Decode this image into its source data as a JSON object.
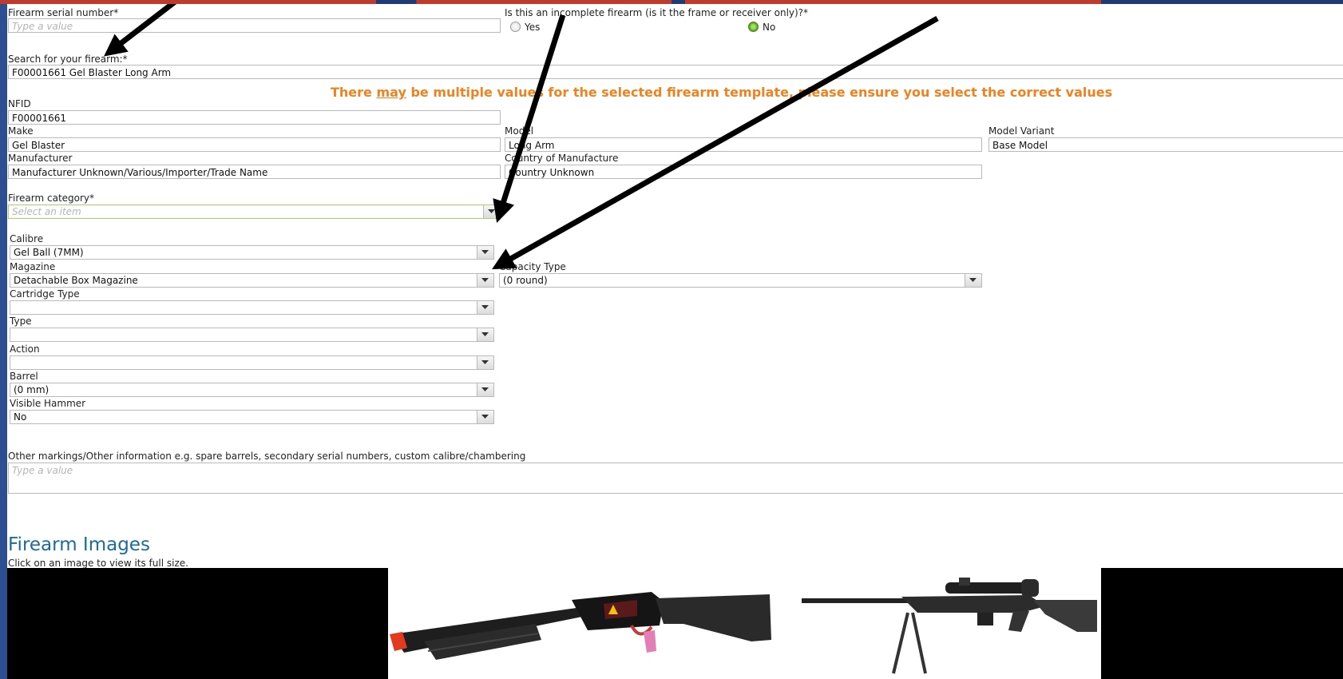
{
  "serial": {
    "label": "Firearm serial number*",
    "placeholder": "Type a value"
  },
  "incomplete": {
    "label": "Is this an incomplete firearm (is it the frame or receiver only)?*",
    "yes": "Yes",
    "no": "No"
  },
  "search": {
    "label": "Search for your firearm:*",
    "value": "F00001661 Gel Blaster Long Arm"
  },
  "notice": {
    "before": "There ",
    "emph": "may",
    "after": " be multiple values for the selected firearm template, please ensure you select the correct values"
  },
  "nfid": {
    "label": "NFID",
    "value": "F00001661"
  },
  "make": {
    "label": "Make",
    "value": "Gel Blaster"
  },
  "model": {
    "label": "Model",
    "value": "Long Arm"
  },
  "variant": {
    "label": "Model Variant",
    "value": "Base Model"
  },
  "manufacturer": {
    "label": "Manufacturer",
    "value": "Manufacturer Unknown/Various/Importer/Trade Name"
  },
  "country": {
    "label": "Country of Manufacture",
    "value": "Country Unknown"
  },
  "category": {
    "label": "Firearm category*",
    "placeholder": "Select an item"
  },
  "calibre": {
    "label": "Calibre",
    "value": "Gel Ball (7MM)"
  },
  "magazine": {
    "label": "Magazine",
    "value": "Detachable Box Magazine"
  },
  "capacity": {
    "label": "Capacity Type",
    "value": "(0 round)"
  },
  "cartridge": {
    "label": "Cartridge Type",
    "value": ""
  },
  "type": {
    "label": "Type",
    "value": ""
  },
  "action": {
    "label": "Action",
    "value": ""
  },
  "barrel": {
    "label": "Barrel",
    "value": "(0 mm)"
  },
  "hammer": {
    "label": "Visible Hammer",
    "value": "No"
  },
  "other": {
    "label": "Other markings/Other information e.g. spare barrels, secondary serial numbers, custom calibre/chambering",
    "placeholder": "Type a value"
  },
  "images": {
    "title": "Firearm Images",
    "hint": "Click on an image to view its full size."
  },
  "colors": {
    "accent": "#f0821e",
    "title": "#1b6b9a",
    "focus": "#a6d16a",
    "radio_on": "#4f9a1c"
  }
}
